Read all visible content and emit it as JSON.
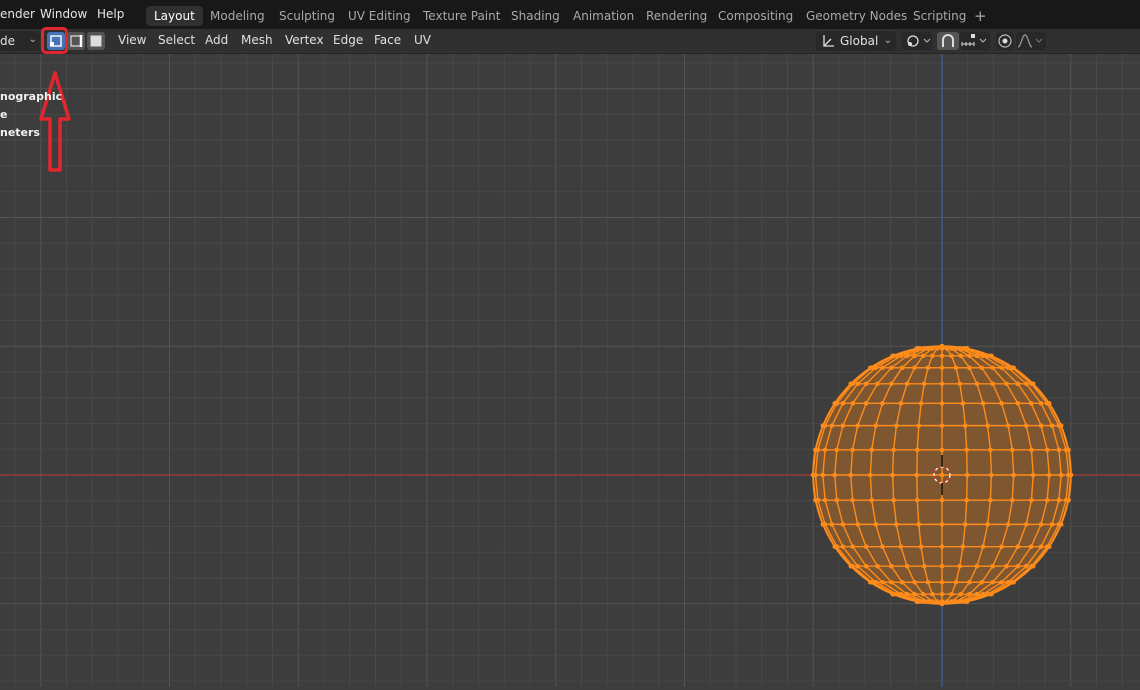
{
  "topbar": {
    "menus": [
      "ender",
      "Window",
      "Help"
    ],
    "workspaces": [
      {
        "label": "Layout",
        "active": true
      },
      {
        "label": "Modeling",
        "active": false
      },
      {
        "label": "Sculpting",
        "active": false
      },
      {
        "label": "UV Editing",
        "active": false
      },
      {
        "label": "Texture Paint",
        "active": false
      },
      {
        "label": "Shading",
        "active": false
      },
      {
        "label": "Animation",
        "active": false
      },
      {
        "label": "Rendering",
        "active": false
      },
      {
        "label": "Compositing",
        "active": false
      },
      {
        "label": "Geometry Nodes",
        "active": false
      },
      {
        "label": "Scripting",
        "active": false
      }
    ],
    "add_tab_icon": "+"
  },
  "header": {
    "mode_label": "de",
    "select_modes": [
      "vertex-select-icon",
      "edge-select-icon",
      "face-select-icon"
    ],
    "menus": [
      "View",
      "Select",
      "Add",
      "Mesh",
      "Vertex",
      "Edge",
      "Face",
      "UV"
    ],
    "transform_orientation": "Global",
    "pivot_icon": "pivot-point-icon",
    "snap_icon": "snap-magnet-icon",
    "proportional_icon": "proportional-edit-icon"
  },
  "viewport": {
    "overlay_lines": [
      "nographic",
      "e",
      "neters"
    ],
    "colors": {
      "background": "#3d3d3d",
      "grid": "#484848",
      "grid_major": "#555555",
      "x_axis": "#c0393b",
      "y_axis": "#3a67b8",
      "mesh_edge": "#ff8c1a",
      "mesh_fill": "#8a5a2e",
      "annotation": "#e3262d"
    },
    "mesh": {
      "type": "uv-sphere",
      "segments": 32,
      "rings": 16,
      "selected": true
    }
  }
}
